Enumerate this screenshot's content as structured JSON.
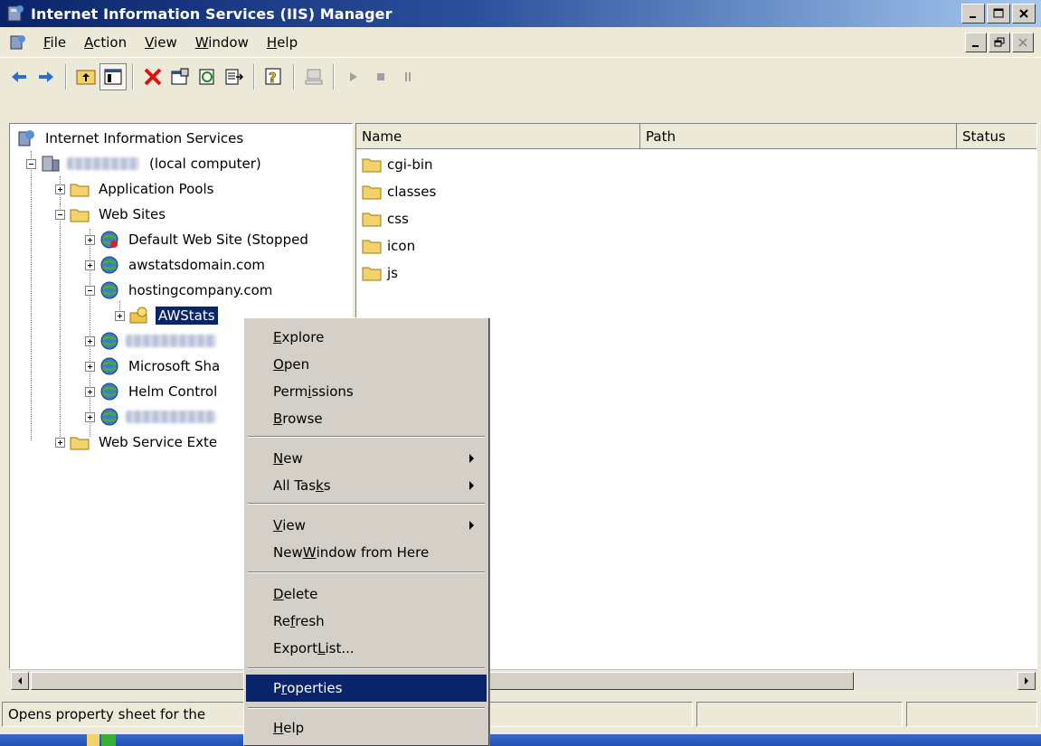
{
  "window": {
    "title": "Internet Information Services (IIS) Manager"
  },
  "menu": {
    "items": [
      {
        "pre": "",
        "key": "F",
        "post": "ile"
      },
      {
        "pre": "",
        "key": "A",
        "post": "ction"
      },
      {
        "pre": "",
        "key": "V",
        "post": "iew"
      },
      {
        "pre": "",
        "key": "W",
        "post": "indow"
      },
      {
        "pre": "",
        "key": "H",
        "post": "elp"
      }
    ]
  },
  "tree": {
    "root": "Internet Information Services",
    "computer_suffix": "(local computer)",
    "app_pools": "Application Pools",
    "web_sites": "Web Sites",
    "sites": [
      "Default Web Site (Stopped",
      "awstatsdomain.com",
      "hostingcompany.com"
    ],
    "awstats": "AWStats",
    "microsoft_sha": "Microsoft Sha",
    "helm_control": "Helm Control",
    "web_service_ext": "Web Service Exte"
  },
  "list": {
    "columns": [
      "Name",
      "Path",
      "Status"
    ],
    "rows": [
      "cgi-bin",
      "classes",
      "css",
      "icon",
      "js"
    ]
  },
  "context_menu": {
    "explore": {
      "pre": "",
      "key": "E",
      "post": "xplore"
    },
    "open": {
      "pre": "",
      "key": "O",
      "post": "pen"
    },
    "permissions": {
      "pre": "Perm",
      "key": "i",
      "post": "ssions"
    },
    "browse": {
      "pre": "",
      "key": "B",
      "post": "rowse"
    },
    "new": {
      "pre": "",
      "key": "N",
      "post": "ew"
    },
    "all_tasks": {
      "pre": "All Tas",
      "key": "k",
      "post": "s"
    },
    "view": {
      "pre": "",
      "key": "V",
      "post": "iew"
    },
    "new_window": {
      "pre": "New ",
      "key": "W",
      "post": "indow from Here"
    },
    "delete": {
      "pre": "",
      "key": "D",
      "post": "elete"
    },
    "refresh": {
      "pre": "Re",
      "key": "f",
      "post": "resh"
    },
    "export_list": {
      "pre": "Export ",
      "key": "L",
      "post": "ist..."
    },
    "properties": {
      "pre": "P",
      "key": "r",
      "post": "operties"
    },
    "help": {
      "pre": "",
      "key": "H",
      "post": "elp"
    }
  },
  "status": {
    "text": "Opens property sheet for the"
  },
  "colors": {
    "selection": "#0a246a",
    "face": "#d4d0c8",
    "titlebar_start": "#0a246a"
  }
}
